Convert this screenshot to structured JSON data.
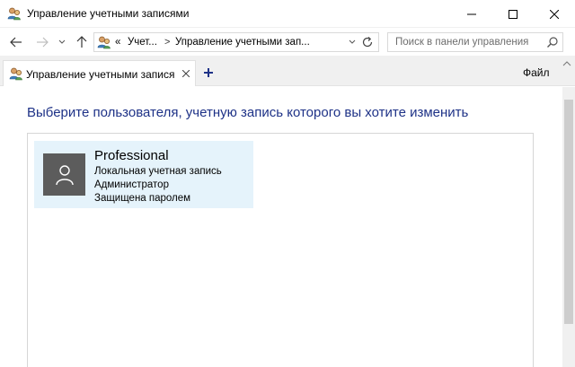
{
  "window": {
    "title": "Управление учетными записями",
    "icons": {
      "app": "users-icon",
      "minimize": "minimize-icon",
      "maximize": "maximize-icon",
      "close": "close-icon"
    }
  },
  "address": {
    "overflow": "«",
    "crumbs": [
      "Учет...",
      "Управление учетными зап..."
    ],
    "search_placeholder": "Поиск в панели управления"
  },
  "tab": {
    "label": "Управление учетными запися",
    "file_menu": "Файл"
  },
  "content": {
    "heading": "Выберите пользователя, учетную запись которого вы хотите изменить",
    "user": {
      "name": "Professional",
      "type": "Локальная учетная запись",
      "role": "Администратор",
      "protection": "Защищена паролем"
    }
  },
  "colors": {
    "heading": "#1e3287",
    "card_background": "#e5f3fb",
    "avatar_background": "#5c5c5c"
  }
}
